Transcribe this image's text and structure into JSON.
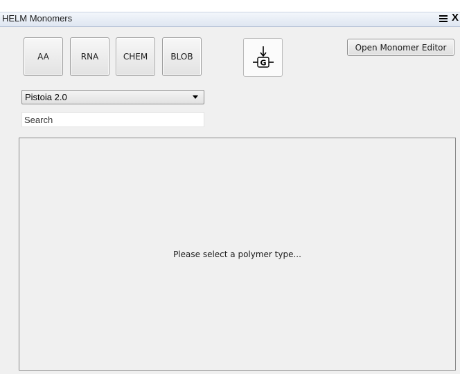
{
  "window": {
    "title": "HELM Monomers",
    "close_glyph": "X",
    "pin_icon": "pin-icon"
  },
  "polymer_buttons": [
    {
      "label": "AA"
    },
    {
      "label": "RNA"
    },
    {
      "label": "CHEM"
    },
    {
      "label": "BLOB"
    }
  ],
  "import_button": {
    "glyph": "G",
    "icon": "import-arrow-g-icon"
  },
  "toolbar": {
    "open_editor_label": "Open Monomer Editor"
  },
  "library_select": {
    "selected": "Pistoia 2.0"
  },
  "search": {
    "placeholder": "Search",
    "value": ""
  },
  "panel": {
    "message": "Please select a polymer type..."
  },
  "colors": {
    "window_bg": "#f0f0f0",
    "border": "#8a8a8a"
  }
}
